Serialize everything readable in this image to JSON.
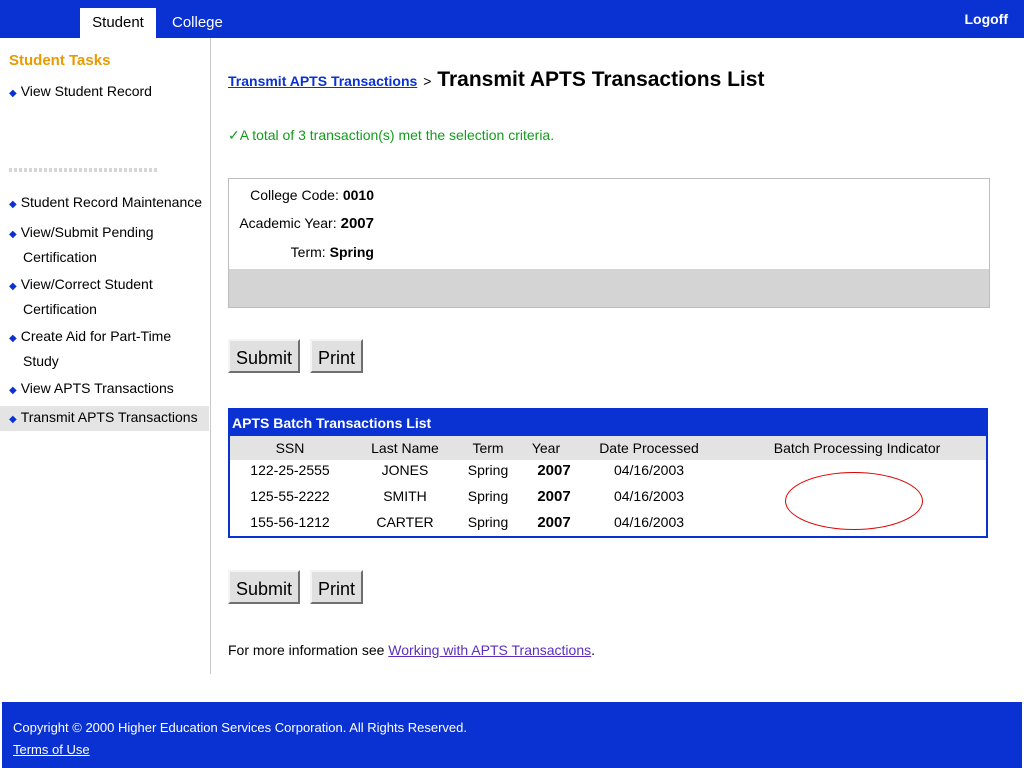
{
  "tabs": {
    "student": "Student",
    "college": "College"
  },
  "header": {
    "logoff": "Logoff"
  },
  "sidebar": {
    "title": "Student Tasks",
    "items": [
      {
        "line1": "View Student Record",
        "line2": ""
      },
      {
        "line1": "Student Record Maintenance",
        "line2": ""
      },
      {
        "line1": "View/Submit Pending",
        "line2": "Certification"
      },
      {
        "line1": "View/Correct Student",
        "line2": "Certification"
      },
      {
        "line1": "Create Aid for Part-Time",
        "line2": "Study"
      },
      {
        "line1": "View APTS Transactions",
        "line2": ""
      },
      {
        "line1": "Transmit APTS Transactions",
        "line2": ""
      }
    ]
  },
  "breadcrumb": {
    "link": "Transmit APTS Transactions",
    "sep": ">",
    "title": "Transmit APTS Transactions List"
  },
  "status": {
    "check": "✓",
    "message": "A total of 3 transaction(s) met the selection criteria."
  },
  "info": {
    "college_code_label": "College Code:",
    "college_code": "0010",
    "academic_year_label": "Academic Year:",
    "academic_year": "2007",
    "term_label": "Term:",
    "term": "Spring"
  },
  "buttons": {
    "submit": "Submit",
    "print": "Print"
  },
  "table": {
    "title": "APTS Batch Transactions List",
    "headers": [
      "SSN",
      "Last Name",
      "Term",
      "Year",
      "Date Processed",
      "Batch Processing Indicator"
    ],
    "rows": [
      [
        "122-25-2555",
        "JONES",
        "Spring",
        "2007",
        "04/16/2003",
        ""
      ],
      [
        "125-55-2222",
        "SMITH",
        "Spring",
        "2007",
        "04/16/2003",
        ""
      ],
      [
        "155-56-1212",
        "CARTER",
        "Spring",
        "2007",
        "04/16/2003",
        ""
      ]
    ]
  },
  "more_info": {
    "prefix": "For more information see ",
    "link": "Working with APTS Transactions",
    "suffix": "."
  },
  "footer": {
    "copyright": "Copyright © 2000 Higher Education Services Corporation. All Rights Reserved.",
    "terms": "Terms of Use"
  },
  "colors": {
    "brand_blue": "#0a32d2",
    "task_orange": "#e89a00",
    "success_green": "#139c1c",
    "annotation_red": "#e00000"
  }
}
